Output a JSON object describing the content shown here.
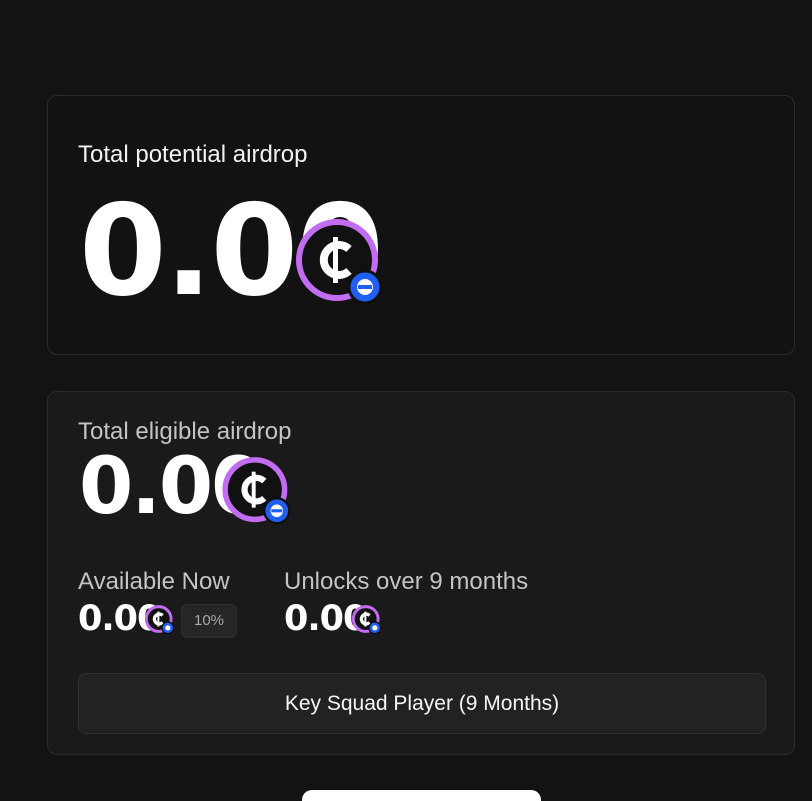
{
  "colors": {
    "page_background": "#131313",
    "coin_ring": "#c26cf2",
    "coin_badge": "#1f5ff2"
  },
  "potential": {
    "label": "Total potential airdrop",
    "amount": "0.00",
    "token_icon": "coin-icon"
  },
  "eligible": {
    "label": "Total eligible airdrop",
    "amount": "0.00",
    "token_icon": "coin-icon",
    "available": {
      "label": "Available Now",
      "amount": "0.00",
      "percent": "10%"
    },
    "unlocks": {
      "label": "Unlocks over 9 months",
      "amount": "0.00"
    },
    "tier_button": "Key Squad Player (9 Months)"
  }
}
